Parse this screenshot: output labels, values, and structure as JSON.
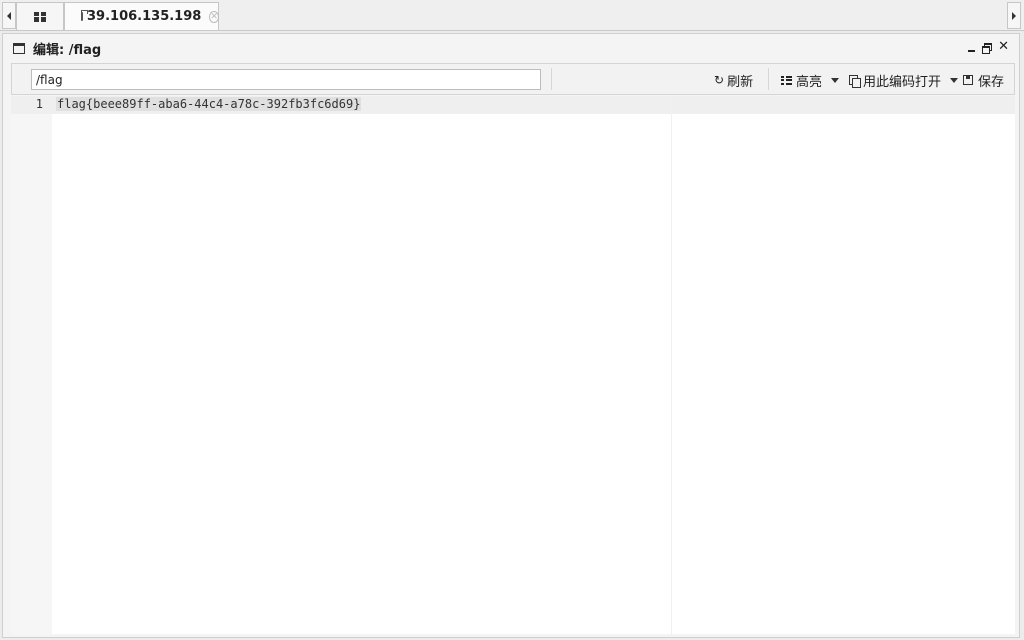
{
  "tabbar": {
    "tabs": [
      {
        "icon": "grid-icon",
        "label": ""
      },
      {
        "icon": "folder-icon",
        "label": "39.106.135.198",
        "closable": true
      }
    ]
  },
  "panel": {
    "icon": "window-icon",
    "title": "编辑: /flag"
  },
  "toolbar": {
    "path_value": "/flag",
    "refresh_label": "刷新",
    "highlight_label": "高亮",
    "open_with_encoding_label": "用此编码打开",
    "save_label": "保存"
  },
  "editor": {
    "lines": [
      {
        "number": "1",
        "text": "flag{beee89ff-aba6-44c4-a78c-392fb3fc6d69}"
      }
    ]
  }
}
